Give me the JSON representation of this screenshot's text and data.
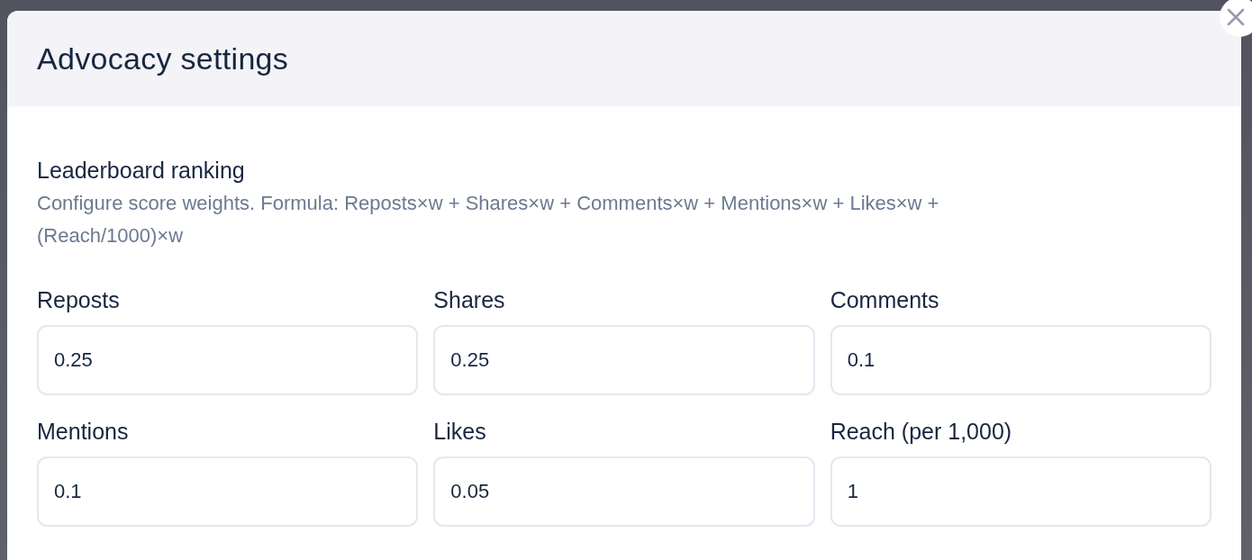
{
  "dialog": {
    "title": "Advocacy settings"
  },
  "section": {
    "title": "Leaderboard ranking",
    "description": "Configure score weights. Formula: Reposts×w + Shares×w + Comments×w + Mentions×w + Likes×w + (Reach/1000)×w"
  },
  "fields": [
    {
      "label": "Reposts",
      "value": "0.25"
    },
    {
      "label": "Shares",
      "value": "0.25"
    },
    {
      "label": "Comments",
      "value": "0.1"
    },
    {
      "label": "Mentions",
      "value": "0.1"
    },
    {
      "label": "Likes",
      "value": "0.05"
    },
    {
      "label": "Reach (per 1,000)",
      "value": "1"
    }
  ]
}
